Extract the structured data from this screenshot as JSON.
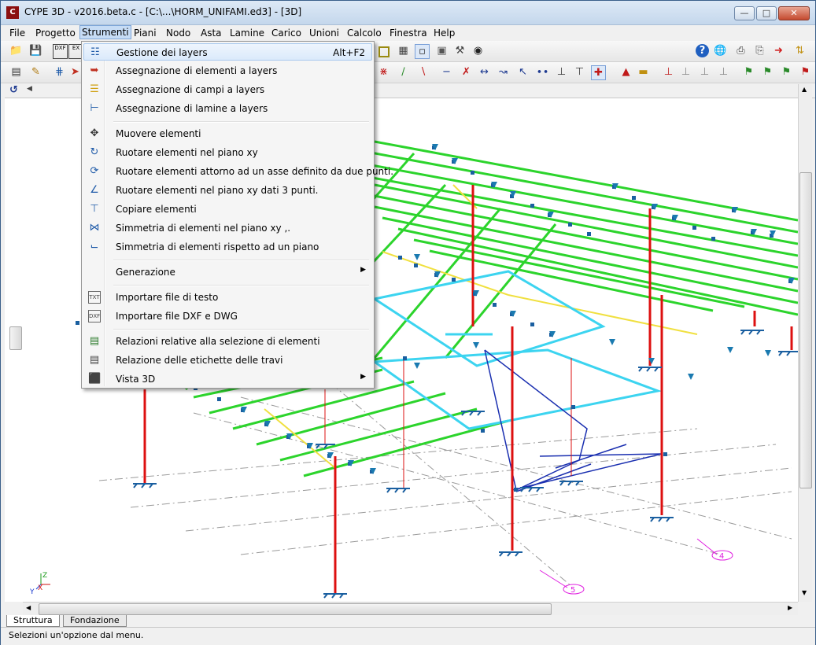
{
  "window": {
    "title": "CYPE 3D - v2016.beta.c - [C:\\...\\HORM_UNIFAMI.ed3] - [3D]",
    "app_icon": "cype-app-icon",
    "controls": [
      "minimize-icon",
      "maximize-icon",
      "close-icon"
    ],
    "mdi_controls": [
      "minimize-icon",
      "restore-icon",
      "close-icon"
    ]
  },
  "menubar": {
    "items": [
      "File",
      "Progetto",
      "Strumenti",
      "Piani",
      "Nodo",
      "Asta",
      "Lamine",
      "Carico",
      "Unioni",
      "Calcolo",
      "Finestra",
      "Help"
    ],
    "active": "Strumenti"
  },
  "toolbar1": {
    "left_icons": [
      "open-folder-icon",
      "save-icon",
      "dxf-icon",
      "export-icon"
    ],
    "mid_icons": [
      "square-select-icon",
      "grid-icon",
      "frame-icon",
      "node-select-icon",
      "binoculars-icon"
    ],
    "right_icons": [
      "help-icon",
      "globe-icon",
      "printer-icon",
      "print-preview-icon",
      "export-red-icon",
      "update-icon"
    ]
  },
  "toolbar2": {
    "icons": [
      "list-icon",
      "edit-icon",
      "layer-icon",
      "assign-icon",
      "beam-icon",
      "node-icon",
      "cross-icon",
      "snap-icon",
      "support-icon",
      "link-icon",
      "release-icon",
      "hinge-icon",
      "mirror-icon",
      "section-icon",
      "load-icon",
      "move-icon",
      "node-check-icon",
      "calc-icon",
      "steel-icon",
      "flag-icon",
      "delete-node-icon",
      "check-icon"
    ]
  },
  "dropdown": {
    "items": [
      {
        "label": "Gestione dei layers",
        "icon": "layers-icon",
        "shortcut": "Alt+F2"
      },
      {
        "label": "Assegnazione di elementi a layers",
        "icon": "assign-elements-icon"
      },
      {
        "label": "Assegnazione di campi a layers",
        "icon": "assign-fields-icon"
      },
      {
        "label": "Assegnazione di lamine a layers",
        "icon": "assign-plates-icon"
      },
      {
        "label": "Muovere elementi",
        "icon": "move-icon"
      },
      {
        "label": "Ruotare elementi nel piano xy",
        "icon": "rotate-xy-icon"
      },
      {
        "label": "Ruotare elementi attorno ad un asse definito da due punti.",
        "icon": "rotate-axis-icon"
      },
      {
        "label": "Ruotare elementi nel piano xy dati 3 punti.",
        "icon": "rotate-3points-icon"
      },
      {
        "label": "Copiare elementi",
        "icon": "copy-icon"
      },
      {
        "label": "Simmetria di elementi nel piano xy  ,.",
        "icon": "mirror-xy-icon"
      },
      {
        "label": "Simmetria di elementi rispetto ad un piano",
        "icon": "mirror-plane-icon"
      },
      {
        "label": "Generazione",
        "icon": "",
        "submenu": true
      },
      {
        "label": "Importare file di testo",
        "icon": "import-text-icon"
      },
      {
        "label": "Importare file DXF e DWG",
        "icon": "import-dxf-icon"
      },
      {
        "label": "Relazioni relative alla selezione di elementi",
        "icon": "report-selection-icon"
      },
      {
        "label": "Relazione delle etichette delle travi",
        "icon": "report-labels-icon"
      },
      {
        "label": "Vista 3D",
        "icon": "cube-3d-icon",
        "submenu": true
      }
    ]
  },
  "viewport": {
    "axis_labels": {
      "x": "X",
      "y": "Y",
      "z": "Z"
    },
    "grid_markers": [
      "4",
      "5"
    ]
  },
  "tabs": [
    {
      "label": "Struttura",
      "active": true
    },
    {
      "label": "Fondazione",
      "active": false
    }
  ],
  "status": {
    "text": "Selezioni un'opzione dal menu."
  },
  "colors": {
    "beam_green": "#2cd42c",
    "column_red": "#dd1010",
    "slab_cyan": "#3cd4f0",
    "brace_blue": "#1a2fb0",
    "node_blue": "#1a5fa0",
    "grid_gray": "#9a9a9a",
    "marker_magenta": "#e020e0"
  }
}
